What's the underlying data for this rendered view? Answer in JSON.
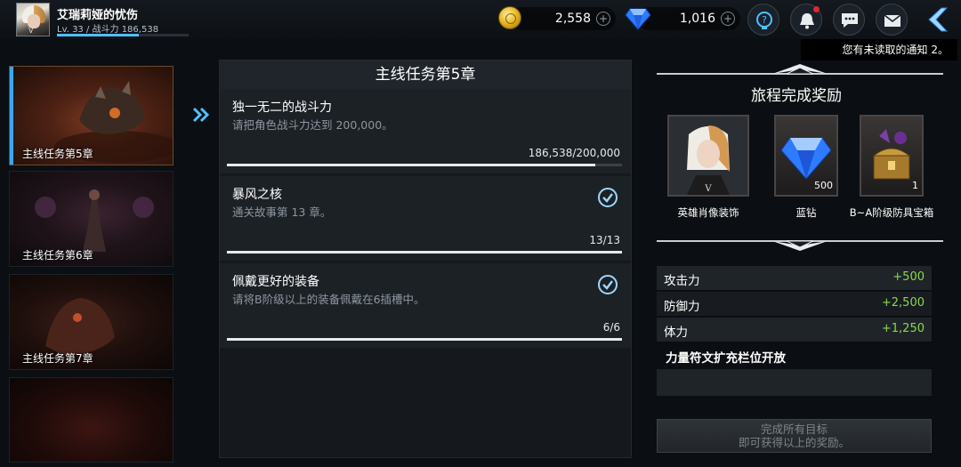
{
  "player": {
    "name": "艾瑞莉娅的忧伤",
    "stats": "Lv. 33 / 战斗力 186,538",
    "rank_glyph": "V",
    "xp_fraction": 0.62
  },
  "currency": {
    "gold": "2,558",
    "gems": "1,016",
    "plus": "+"
  },
  "top_buttons": [
    "help-icon",
    "bell-icon",
    "chat-icon",
    "mail-icon",
    "back-icon"
  ],
  "notification_banner": "您有未读取的通知 2。",
  "chapters": [
    {
      "label": "主线任务第5章",
      "active": true
    },
    {
      "label": "主线任务第6章",
      "active": false
    },
    {
      "label": "主线任务第7章",
      "active": false
    },
    {
      "label": "",
      "active": false
    }
  ],
  "mission": {
    "title": "主线任务第5章",
    "tasks": [
      {
        "title": "独一无二的战斗力",
        "desc": "请把角色战斗力达到 200,000。",
        "progress": "186,538/200,000",
        "fraction": 0.933,
        "completed": false
      },
      {
        "title": "暴风之核",
        "desc": "通关故事第 13 章。",
        "progress": "13/13",
        "fraction": 1.0,
        "completed": true
      },
      {
        "title": "佩戴更好的装备",
        "desc": "请将B阶级以上的装备佩戴在6插槽中。",
        "progress": "6/6",
        "fraction": 1.0,
        "completed": true
      }
    ]
  },
  "rewards": {
    "title": "旅程完成奖励",
    "items": [
      {
        "name": "英雄肖像装饰",
        "qty": "",
        "icon": "hero-portrait-icon"
      },
      {
        "name": "蓝钻",
        "qty": "500",
        "icon": "blue-diamond-icon"
      },
      {
        "name": "B~A阶级防具宝箱",
        "qty": "1",
        "icon": "armor-chest-icon"
      }
    ],
    "stats": [
      {
        "name": "攻击力",
        "value": "+500"
      },
      {
        "name": "防御力",
        "value": "+2,500"
      },
      {
        "name": "体力",
        "value": "+1,250"
      }
    ],
    "unlock": "力量符文扩充栏位开放",
    "claim_button": "完成所有目标\n即可获得以上的奖励。",
    "colors": {
      "positive": "#8bd84a"
    }
  }
}
